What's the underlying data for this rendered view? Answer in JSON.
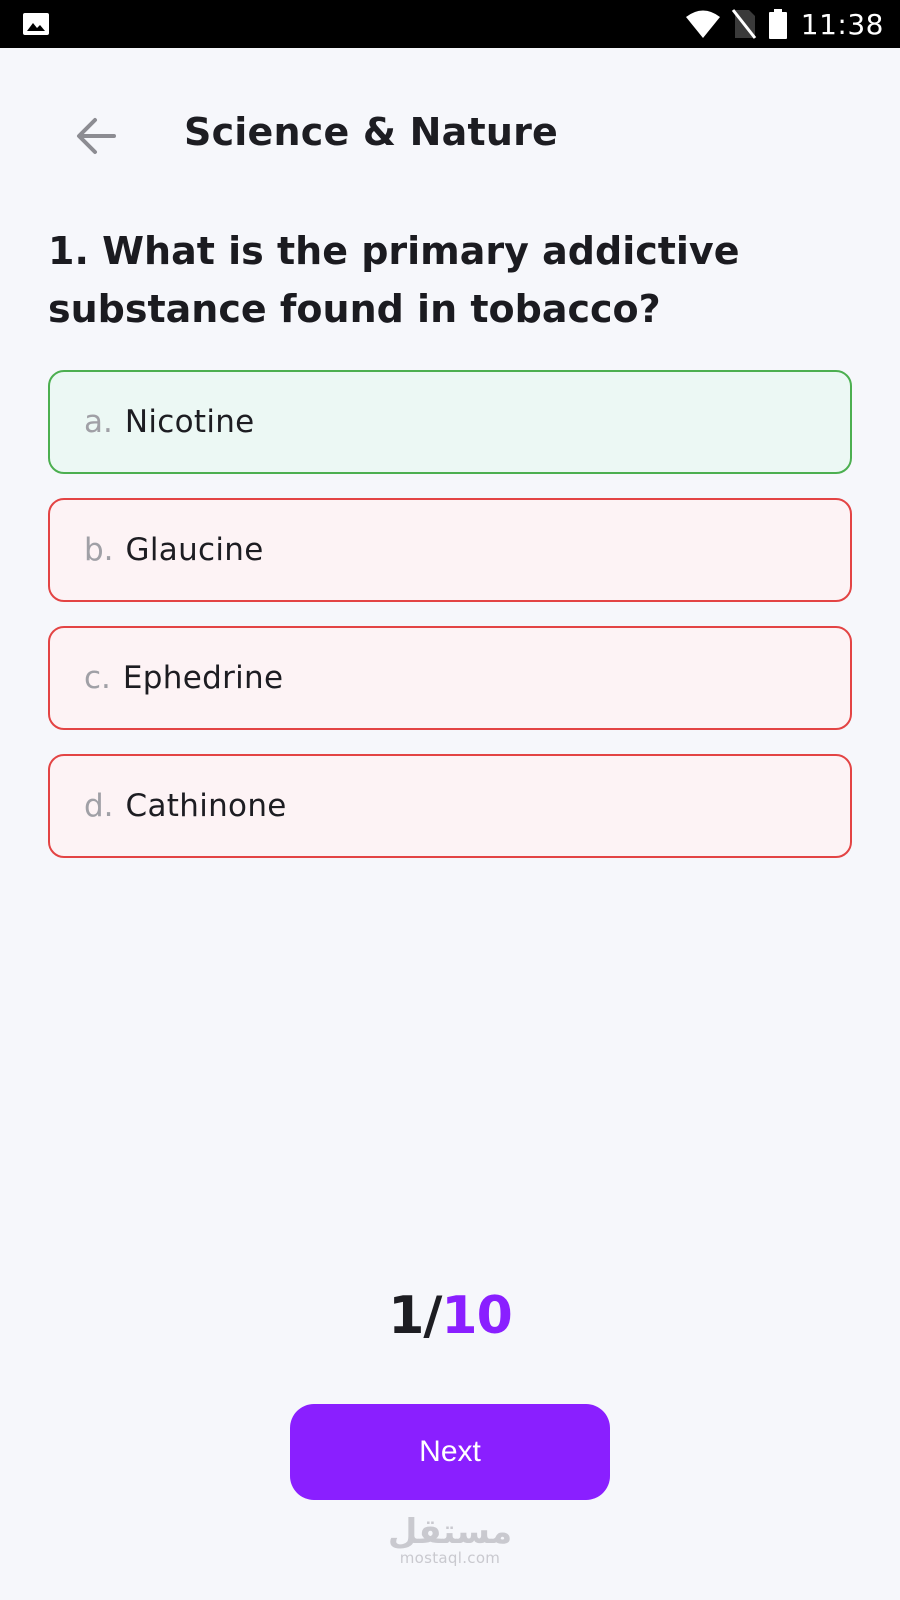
{
  "status_bar": {
    "time": "11:38",
    "icons": [
      "gallery-icon",
      "wifi-icon",
      "no-sim-icon",
      "battery-icon"
    ]
  },
  "header": {
    "title": "Science & Nature",
    "back_icon": "arrow-left-icon"
  },
  "question": {
    "text": "1. What is the primary addictive substance found in tobacco?"
  },
  "options": [
    {
      "letter": "a.",
      "text": "Nicotine",
      "state": "correct"
    },
    {
      "letter": "b.",
      "text": "Glaucine",
      "state": "incorrect"
    },
    {
      "letter": "c.",
      "text": "Ephedrine",
      "state": "incorrect"
    },
    {
      "letter": "d.",
      "text": "Cathinone",
      "state": "incorrect"
    }
  ],
  "progress": {
    "current": "1/",
    "total": "10"
  },
  "next_button": {
    "label": "Next"
  },
  "watermark": {
    "arabic": "مستقل",
    "latin": "mostaql.com"
  },
  "colors": {
    "accent": "#8a1fff",
    "correct_border": "#4caf50",
    "correct_bg": "#ecf8f4",
    "incorrect_border": "#e34444",
    "incorrect_bg": "#fdf3f5",
    "background": "#f6f7fb"
  }
}
